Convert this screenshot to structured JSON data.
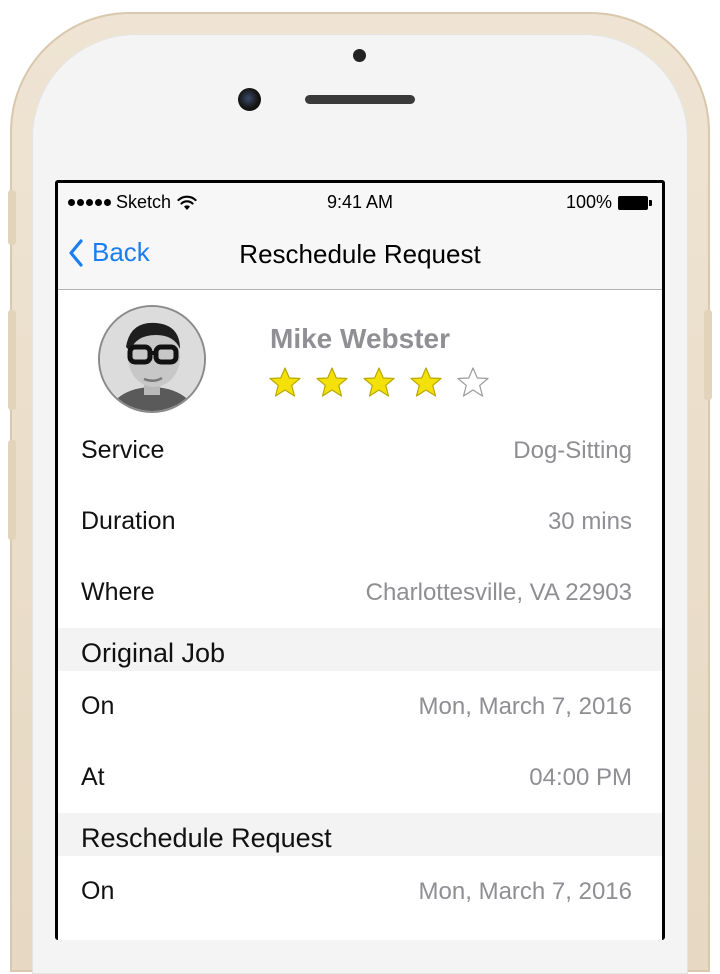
{
  "status_bar": {
    "carrier": "Sketch",
    "time": "9:41 AM",
    "battery": "100%"
  },
  "nav": {
    "back_label": "Back",
    "title": "Reschedule Request"
  },
  "profile": {
    "name": "Mike Webster",
    "rating": 4,
    "rating_max": 5
  },
  "details": [
    {
      "label": "Service",
      "value": "Dog-Sitting"
    },
    {
      "label": "Duration",
      "value": "30 mins"
    },
    {
      "label": "Where",
      "value": "Charlottesville, VA 22903"
    }
  ],
  "original_job": {
    "header": "Original Job",
    "rows": [
      {
        "label": "On",
        "value": "Mon, March 7, 2016"
      },
      {
        "label": "At",
        "value": "04:00 PM"
      }
    ]
  },
  "reschedule_request": {
    "header": "Reschedule Request",
    "rows": [
      {
        "label": "On",
        "value": "Mon, March 7, 2016"
      }
    ]
  },
  "colors": {
    "accent": "#1a7df2",
    "star_fill": "#f5e10a",
    "secondary_text": "#8e8e93"
  }
}
